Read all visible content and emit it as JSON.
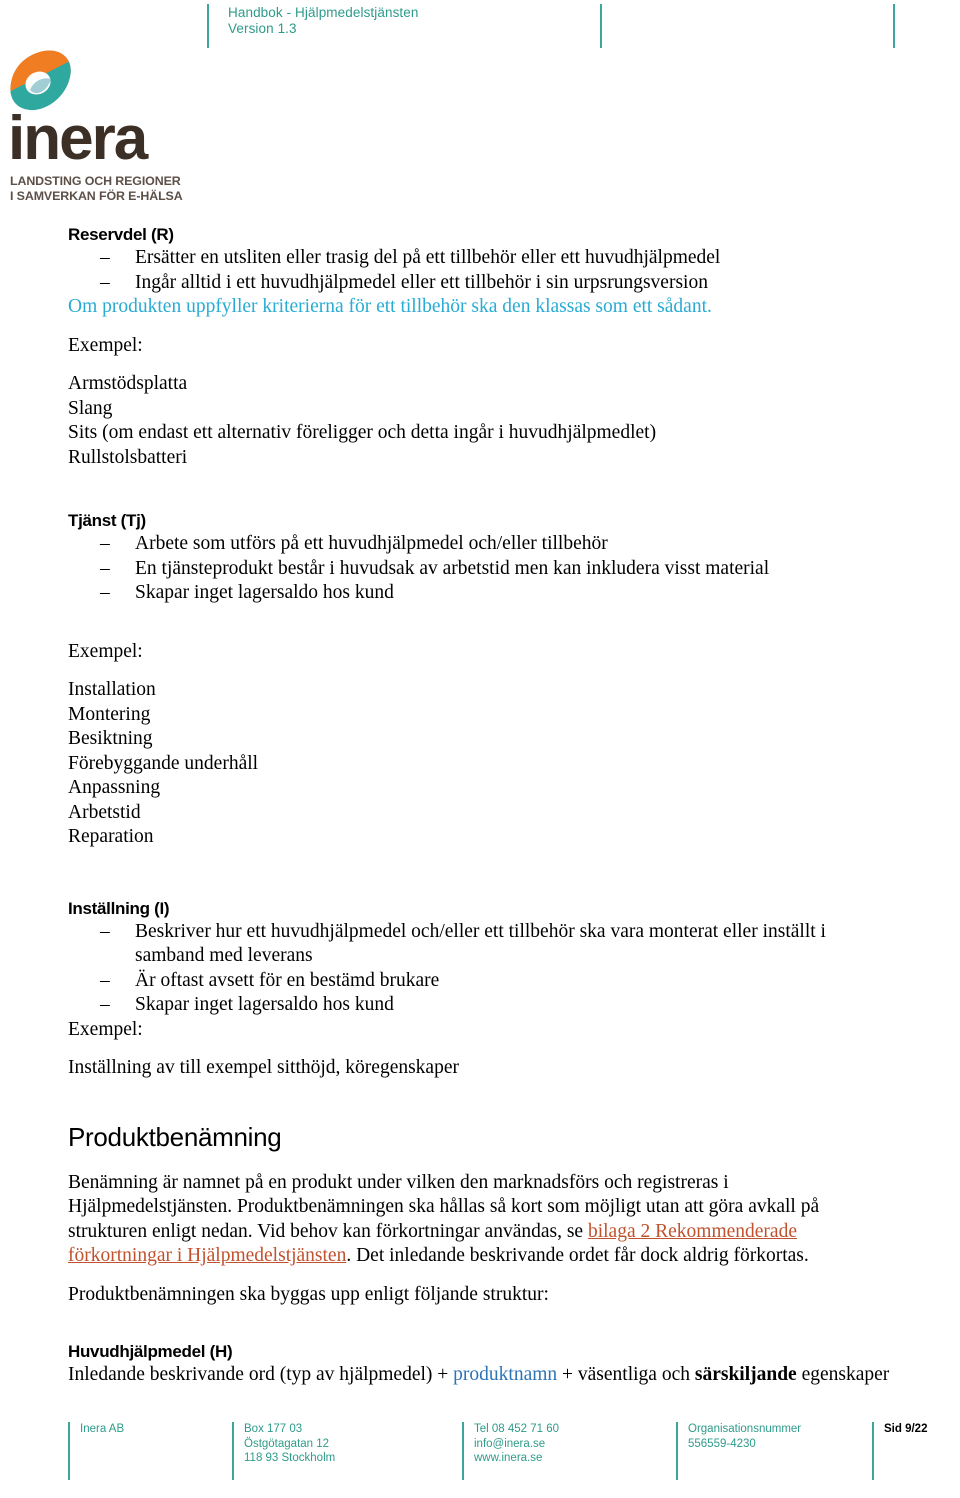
{
  "header": {
    "title": "Handbok - Hjälpmedelstjänsten",
    "version": "Version 1.3",
    "accent_color": "#2e9b8a"
  },
  "logo": {
    "wordmark": "inera",
    "tagline_line1": "LANDSTING OCH REGIONER",
    "tagline_line2": "I SAMVERKAN FÖR E-HÄLSA",
    "mark_color_top": "#f07d22",
    "mark_color_bottom": "#2fa8a0"
  },
  "sections": {
    "reservdel": {
      "heading": "Reservdel (R)",
      "bullets": [
        "Ersätter en utsliten eller trasig del på ett tillbehör eller ett huvudhjälpmedel",
        "Ingår alltid i ett huvudhjälpmedel eller ett tillbehör i sin urpsrungsversion"
      ],
      "note": "Om produkten uppfyller kriterierna för ett tillbehör ska den klassas som ett sådant.",
      "note_color": "#29abd4",
      "example_label": "Exempel:",
      "examples": [
        "Armstödsplatta",
        "Slang",
        "Sits (om endast ett alternativ föreligger och detta ingår i huvudhjälpmedlet)",
        "Rullstolsbatteri"
      ]
    },
    "tjanst": {
      "heading": "Tjänst (Tj)",
      "bullets": [
        "Arbete som utförs på ett huvudhjälpmedel och/eller tillbehör",
        "En tjänsteprodukt består i huvudsak av arbetstid men kan inkludera visst material",
        "Skapar inget lagersaldo hos kund"
      ],
      "example_label": "Exempel:",
      "examples": [
        "Installation",
        "Montering",
        "Besiktning",
        "Förebyggande underhåll",
        "Anpassning",
        "Arbetstid",
        "Reparation"
      ]
    },
    "installning": {
      "heading": "Inställning (I)",
      "bullets": [
        "Beskriver hur ett huvudhjälpmedel och/eller ett tillbehör ska vara monterat eller inställt i samband med leverans",
        "Är oftast avsett för en bestämd brukare",
        "Skapar inget lagersaldo hos kund"
      ],
      "example_label": "Exempel:",
      "examples": [
        "Inställning av till exempel sitthöjd, köregenskaper"
      ]
    },
    "produktbenamning": {
      "heading": "Produktbenämning",
      "paragraph_part1": "Benämning är namnet på en produkt under vilken den marknadsförs och registreras i Hjälpmedelstjänsten. Produktbenämningen ska hållas så kort som möjligt utan att göra avkall på strukturen enligt nedan. Vid behov kan förkortningar användas, se ",
      "link_text": "bilaga 2 Rekommenderade förkortningar i Hjälpmedelstjänsten",
      "link_color": "#c0522d",
      "paragraph_part2": ". Det inledande beskrivande ordet får dock aldrig förkortas.",
      "paragraph2": "Produktbenämningen ska byggas upp enligt följande struktur:"
    },
    "huvudhjalpmedel": {
      "heading": "Huvudhjälpmedel (H)",
      "line_part1": "Inledande beskrivande ord (typ av hjälpmedel) + ",
      "line_highlight": "produktnamn",
      "highlight_color": "#2e74b5",
      "line_part2": " + väsentliga och ",
      "line_bold": "särskiljande",
      "line_part3": " egenskaper"
    }
  },
  "footer": {
    "company": "Inera AB",
    "address_line1": "Box 177 03",
    "address_line2": "Östgötagatan 12",
    "address_line3": "118 93 Stockholm",
    "contact_line1": "Tel 08 452 71 60",
    "contact_line2": "info@inera.se",
    "contact_line3": "www.inera.se",
    "org_label": "Organisationsnummer",
    "org_number": "556559-4230",
    "page_number": "Sid 9/22"
  }
}
